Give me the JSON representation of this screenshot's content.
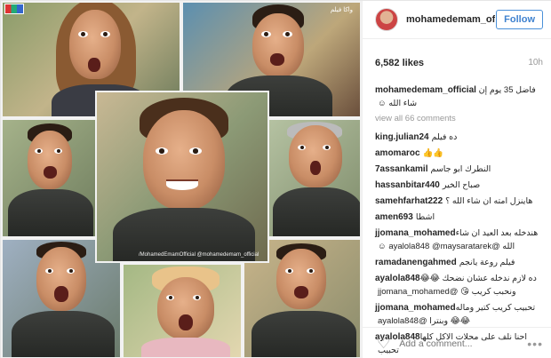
{
  "post": {
    "username": "mohamedemam_of...",
    "follow_label": "Follow",
    "likes": "6,582 likes",
    "time": "10h",
    "caption_user": "mohamedemam_official",
    "caption_text": "فاضل 35 يوم إن شاء الله ☺",
    "view_all": "view all 66 comments"
  },
  "comments": [
    {
      "user": "king.julian24",
      "text": "ده فيلم"
    },
    {
      "user": "amomaroc",
      "text": "👍👍"
    },
    {
      "user": "7assankamil",
      "text": "النطرك ابو جاسم"
    },
    {
      "user": "hassanbitar440",
      "text": "صباح الخير"
    },
    {
      "user": "samehfarhat222",
      "text": "هاينزل امته ان شاء الله ؟"
    },
    {
      "user": "amen693",
      "text": "اشطا"
    },
    {
      "user": "jjomana_mohamed",
      "text": "هندخله بعد العيد ان شاء الله @ayalola848 @maysaratarek ☺"
    },
    {
      "user": "ramadanengahmed",
      "text": "فيلم روعة يانجم"
    },
    {
      "user": "ayalola848",
      "text": "ده لازم ندخله عشان نضحك 😂😂 ونحبب كريب 😘 @jjomana_mohamed"
    },
    {
      "user": "jjomana_mohamed",
      "text": "تحبيب كريب كتير وماله 😂😂 وبنترا @ayalola848"
    },
    {
      "user": "ayalola848",
      "text": "احنا نلف على محلات الاكل كلها تحبيب"
    }
  ],
  "add_comment": {
    "placeholder": "Add a comment..."
  },
  "photo": {
    "watermark": "/MohamedEmamOfficial  @mohamedemam_official",
    "corner_text": "واكا فيلم"
  },
  "colors": {
    "accent": "#3f82cf",
    "muted": "#999999"
  }
}
